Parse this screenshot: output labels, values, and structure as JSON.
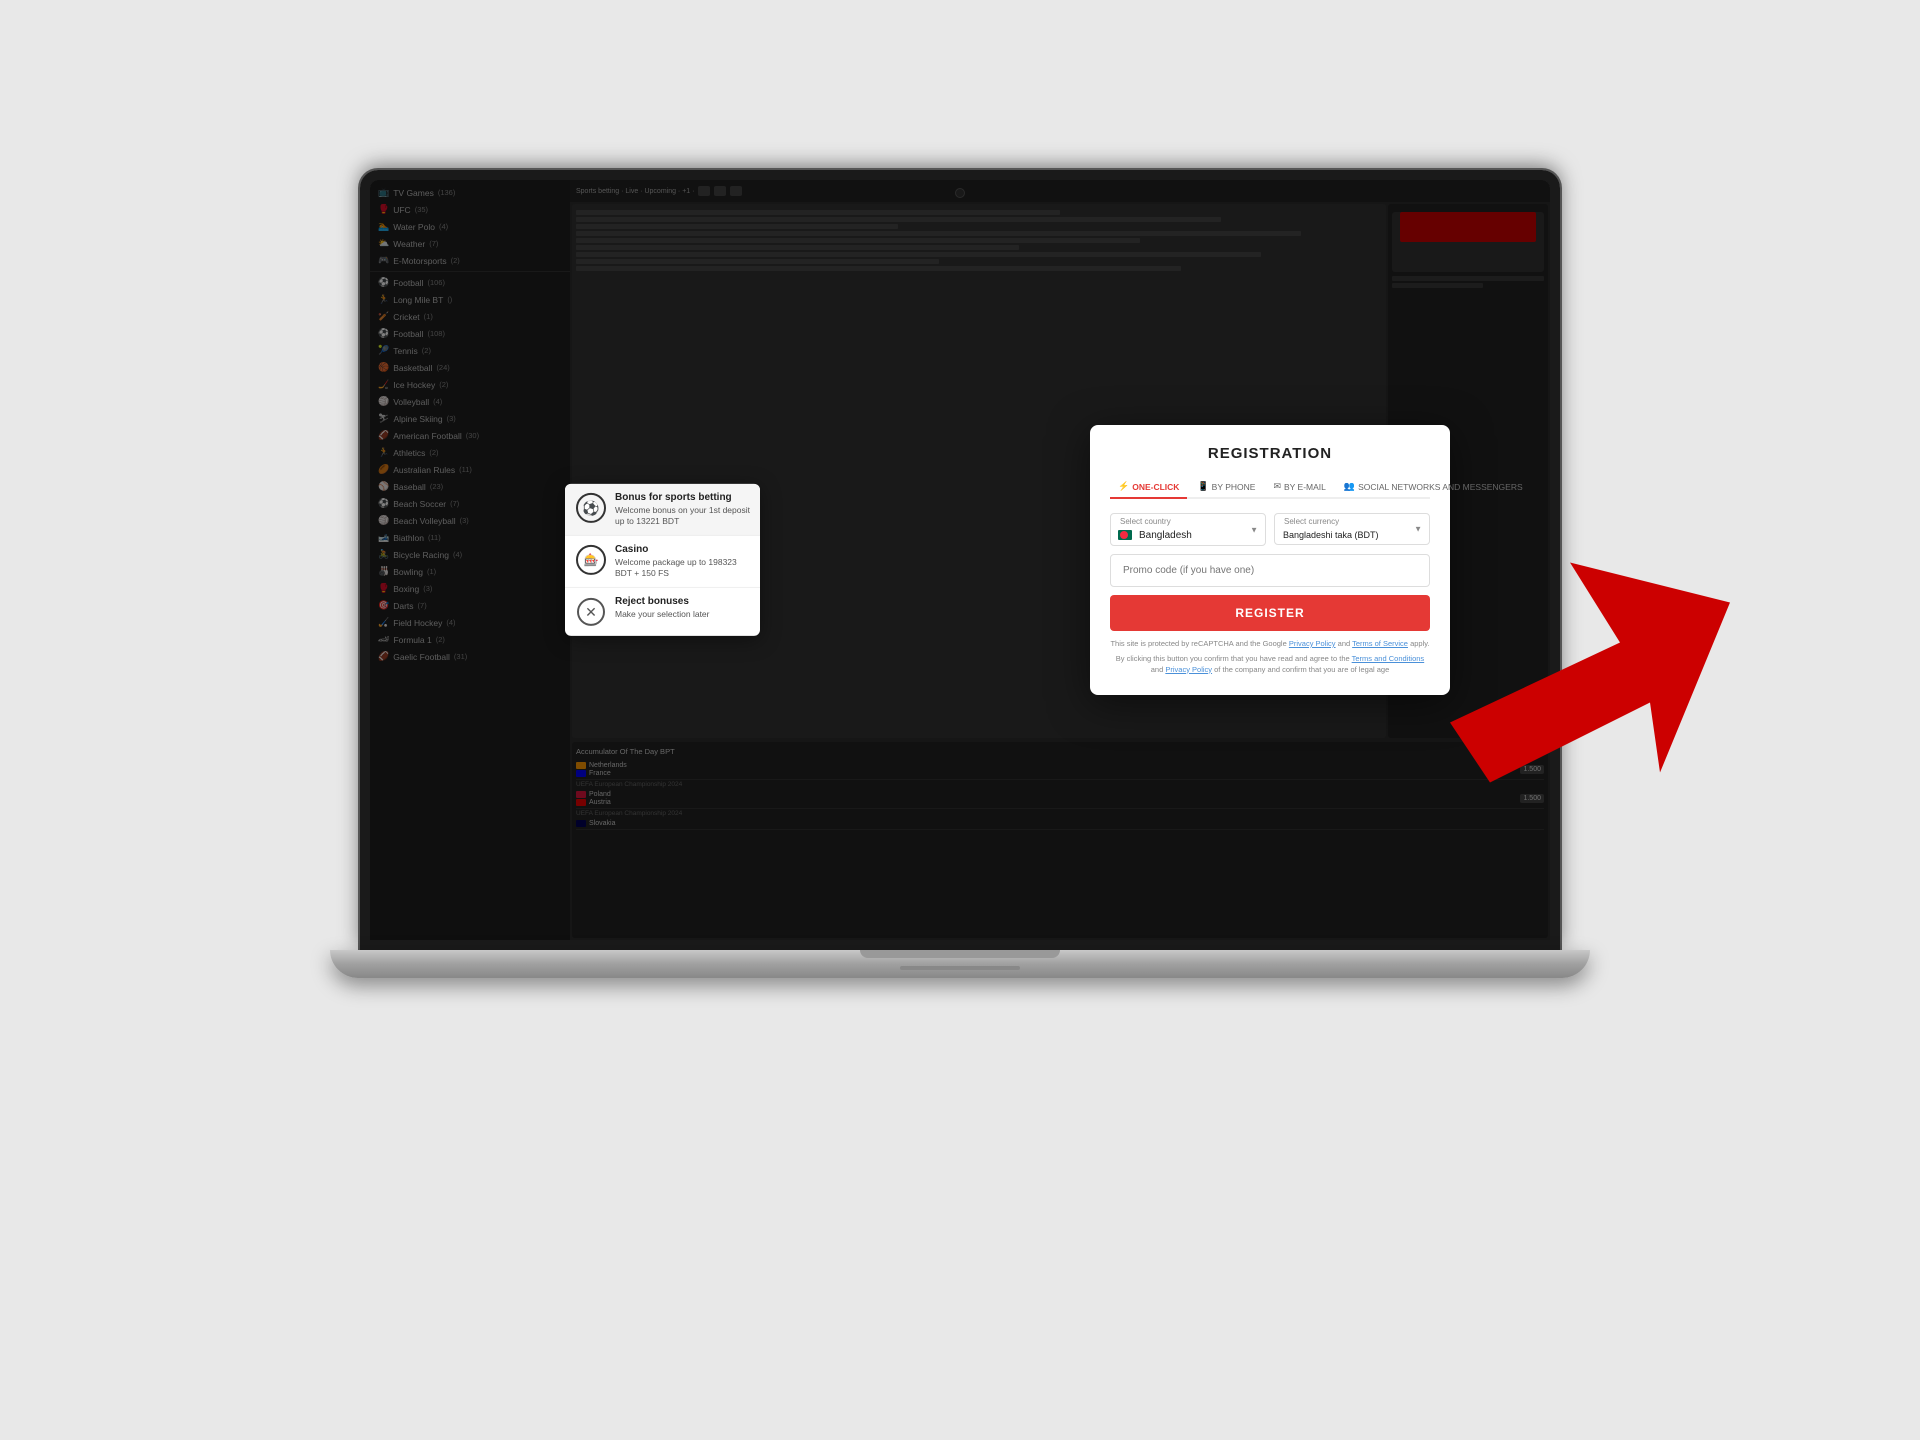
{
  "laptop": {
    "camera_label": "camera"
  },
  "sidebar": {
    "items": [
      {
        "label": "TV Games",
        "count": "(136)",
        "icon": "tv"
      },
      {
        "label": "UFC",
        "count": "(35)",
        "icon": "sports"
      },
      {
        "label": "Water Polo",
        "count": "(4)",
        "icon": "sports"
      },
      {
        "label": "Weather",
        "count": "(7)",
        "icon": "weather"
      },
      {
        "label": "E-Motorsports",
        "count": "(2)",
        "icon": "sports"
      },
      {
        "label": "Football",
        "count": "(106)",
        "icon": "football"
      },
      {
        "label": "Long Mile BT",
        "count": "()",
        "icon": "sports"
      },
      {
        "label": "Cricket",
        "count": "(1)",
        "icon": "sports"
      },
      {
        "label": "Football",
        "count": "(108)",
        "icon": "football"
      },
      {
        "label": "Tennis",
        "count": "(2)",
        "icon": "sports"
      },
      {
        "label": "Basketball",
        "count": "(24)",
        "icon": "sports"
      },
      {
        "label": "Ice Hockey",
        "count": "(2)",
        "icon": "sports"
      },
      {
        "label": "Volleyball",
        "count": "(4)",
        "icon": "sports"
      },
      {
        "label": "Alpine Skiing",
        "count": "(3)",
        "icon": "sports"
      },
      {
        "label": "American Football",
        "count": "(30)",
        "icon": "sports"
      },
      {
        "label": "Athletics",
        "count": "(2)",
        "icon": "sports"
      },
      {
        "label": "Australian Rules",
        "count": "(11)",
        "icon": "sports"
      },
      {
        "label": "Baseball",
        "count": "(23)",
        "icon": "sports"
      },
      {
        "label": "Beach Soccer",
        "count": "(7)",
        "icon": "sports"
      },
      {
        "label": "Beach Volleyball",
        "count": "(3)",
        "icon": "sports"
      },
      {
        "label": "Biathlon",
        "count": "(11)",
        "icon": "sports"
      },
      {
        "label": "Bicycle Racing",
        "count": "(4)",
        "icon": "sports"
      },
      {
        "label": "Bowling",
        "count": "(1)",
        "icon": "sports"
      },
      {
        "label": "Boxing",
        "count": "(3)",
        "icon": "sports"
      },
      {
        "label": "Darts",
        "count": "(7)",
        "icon": "sports"
      },
      {
        "label": "Field Hockey",
        "count": "(4)",
        "icon": "sports"
      },
      {
        "label": "Formula 1",
        "count": "(2)",
        "icon": "sports"
      },
      {
        "label": "Gaelic Football",
        "count": "(31)",
        "icon": "sports"
      }
    ]
  },
  "bonus_panel": {
    "sports_title": "Bonus for sports betting",
    "sports_desc": "Welcome bonus on your 1st deposit up to 13221 BDT",
    "casino_title": "Casino",
    "casino_desc": "Welcome package up to 198323 BDT + 150 FS",
    "reject_title": "Reject bonuses",
    "reject_desc": "Make your selection later"
  },
  "registration": {
    "title": "REGISTRATION",
    "tabs": [
      {
        "label": "ONE-CLICK",
        "icon": "⚡",
        "active": true
      },
      {
        "label": "BY PHONE",
        "icon": "📱",
        "active": false
      },
      {
        "label": "BY E-MAIL",
        "icon": "✉",
        "active": false
      },
      {
        "label": "SOCIAL NETWORKS AND MESSENGERS",
        "icon": "👥",
        "active": false
      }
    ],
    "country_label": "Select country",
    "country_value": "Bangladesh",
    "currency_label": "Select currency",
    "currency_value": "Bangladeshi taka (BDT)",
    "promo_placeholder": "Promo code (if you have one)",
    "register_btn": "REGISTER",
    "recaptcha_text": "This site is protected by reCAPTCHA and the Google",
    "privacy_policy": "Privacy Policy",
    "terms_of_service": "Terms of Service",
    "recaptcha_suffix": "apply.",
    "terms_text": "By clicking this button you confirm that you have read and agree to the",
    "terms_and_conditions": "Terms and Conditions",
    "and": "and",
    "privacy_policy2": "Privacy Policy",
    "terms_suffix": "of the company and confirm that you are of legal age"
  },
  "lower_panels": {
    "accumulator_title": "Accumulator Of The Day BPT",
    "matches": [
      {
        "team1": "Netherlands",
        "team2": "France",
        "flag1": "nl",
        "flag2": "fr",
        "odds": "1.500"
      },
      {
        "team1": "Poland",
        "team2": "Austria",
        "flag1": "pl",
        "flag2": "at",
        "time": "UEFA European Championship 2024",
        "odds": "1.500"
      },
      {
        "team1": "Slovakia",
        "flag1": "sk",
        "time": "",
        "odds": ""
      }
    ]
  },
  "colors": {
    "accent_red": "#e53935",
    "tab_active": "#e53935",
    "bg_dark": "#2d2d2d",
    "sidebar_bg": "#1e1e1e",
    "modal_bg": "#ffffff"
  }
}
